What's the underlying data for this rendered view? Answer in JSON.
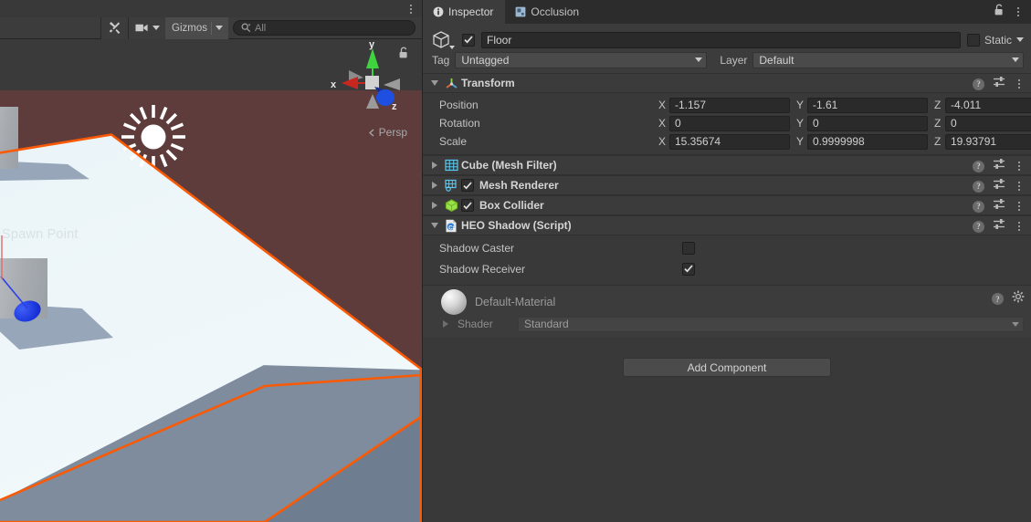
{
  "scene": {
    "toolbar": {
      "tools_icon": "tools-wrench-icon",
      "camera_icon": "camera-icon",
      "gizmos_label": "Gizmos",
      "search_placeholder": "All",
      "search_value": "",
      "search_icon": "search-icon",
      "kebab_icon": "kebab-menu-icon"
    },
    "gizmo": {
      "axis_x": "x",
      "axis_y": "y",
      "axis_z": "z",
      "projection": "Persp",
      "lock_icon": "unlocked-padlock-icon",
      "color_x": "#c8271f",
      "color_y": "#3fd33f",
      "color_z": "#2b5ed6"
    },
    "objects": {
      "light_gizmo": "directional-light-sun-icon",
      "spawn_point_label": "Spawn Point"
    },
    "colors": {
      "background_top": "#3a3a3a",
      "background_maroon": "#5e3c3c",
      "floor_surface": "#eef6f9",
      "floor_side": "#7e8c9e",
      "selection_outline": "#fa5a05",
      "shadow": "#97a7b9"
    }
  },
  "inspector": {
    "tabs": [
      {
        "label": "Inspector",
        "icon": "info-circle-icon",
        "active": true
      },
      {
        "label": "Occlusion",
        "icon": "occlusion-icon",
        "active": false
      }
    ],
    "lock_icon": "unlocked-padlock-icon",
    "kebab_icon": "kebab-menu-icon",
    "gameobject": {
      "icon": "cube-gameobject-icon",
      "enabled": true,
      "name": "Floor",
      "static_label": "Static",
      "static_checked": false,
      "tag_label": "Tag",
      "tag_value": "Untagged",
      "layer_label": "Layer",
      "layer_value": "Default"
    },
    "components": [
      {
        "title": "Transform",
        "icon": "transform-axes-icon",
        "expanded": true,
        "has_enable_toggle": false,
        "rows": [
          {
            "label": "Position",
            "x": "-1.157",
            "y": "-1.61",
            "z": "-4.011"
          },
          {
            "label": "Rotation",
            "x": "0",
            "y": "0",
            "z": "0"
          },
          {
            "label": "Scale",
            "x": "15.35674",
            "y": "0.9999998",
            "z": "19.93791"
          }
        ],
        "axis_labels": {
          "x": "X",
          "y": "Y",
          "z": "Z"
        }
      },
      {
        "title": "Cube (Mesh Filter)",
        "icon": "mesh-filter-icon",
        "expanded": false,
        "has_enable_toggle": false
      },
      {
        "title": "Mesh Renderer",
        "icon": "mesh-renderer-icon",
        "expanded": false,
        "has_enable_toggle": true,
        "enabled": true
      },
      {
        "title": "Box Collider",
        "icon": "box-collider-icon",
        "expanded": false,
        "has_enable_toggle": true,
        "enabled": true
      },
      {
        "title": "HEO Shadow (Script)",
        "icon": "csharp-script-icon",
        "expanded": true,
        "has_enable_toggle": false,
        "properties": [
          {
            "label": "Shadow Caster",
            "checked": false,
            "highlighted": false
          },
          {
            "label": "Shadow Receiver",
            "checked": true,
            "highlighted": true
          }
        ]
      }
    ],
    "row_icons": {
      "help": "?",
      "help_name": "help-icon",
      "preset": "preset-sliders-icon",
      "kebab": "kebab-menu-icon"
    },
    "material": {
      "name": "Default-Material",
      "preview_icon": "material-sphere-preview",
      "shader_label": "Shader",
      "shader_value": "Standard",
      "help_icon": "help-icon",
      "gear_icon": "gear-icon"
    },
    "add_component_label": "Add Component"
  },
  "annotation": {
    "highlight_color": "#f01a0e",
    "target": "shadow-receiver-checkbox"
  }
}
